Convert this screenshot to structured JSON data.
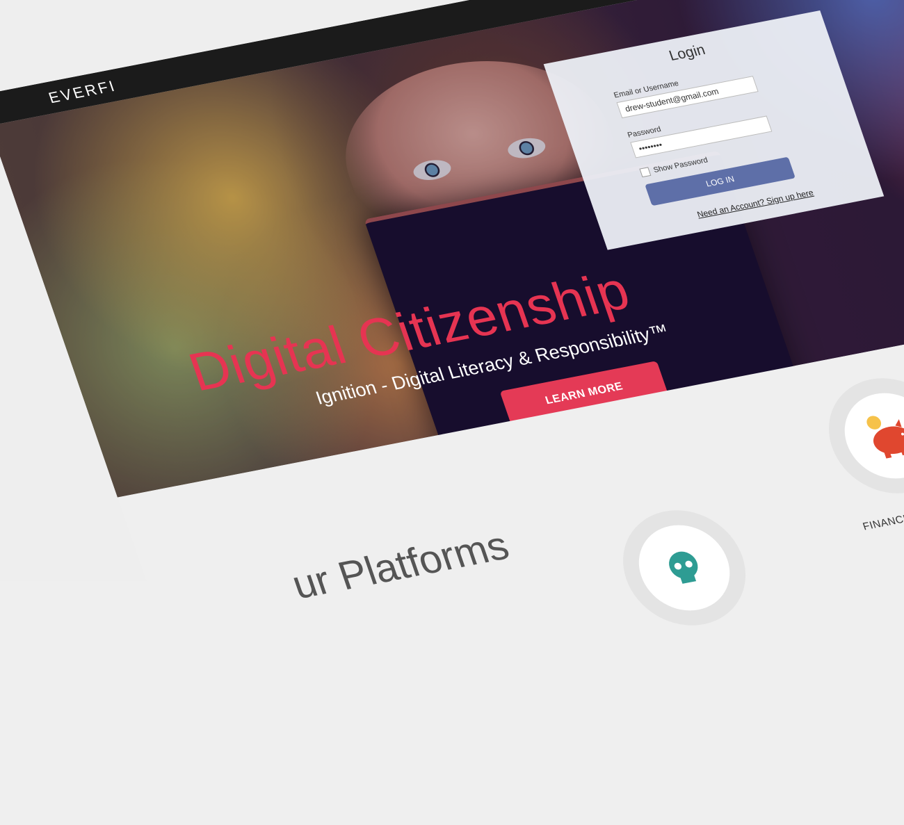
{
  "brand": {
    "logo": "EVERFI"
  },
  "hero": {
    "title": "Digital Citizenship",
    "subtitle": "Ignition - Digital Literacy & Responsibility™",
    "cta_label": "LEARN MORE"
  },
  "login": {
    "title": "Login",
    "email_label": "Email or Username",
    "email_value": "drew-student@gmail.com",
    "password_label": "Password",
    "password_value": "••••••••",
    "show_password_label": "Show Password",
    "submit_label": "LOG IN",
    "signup_link": "Need an Account? Sign up here"
  },
  "platforms": {
    "heading": "ur Platforms",
    "items": [
      {
        "label": "FINANCIAL LITERACY",
        "icon": "piggy-bank-icon"
      },
      {
        "label": "",
        "icon": "skull-icon"
      }
    ]
  },
  "colors": {
    "accent": "#e43a56",
    "login_button": "#5e6fa8",
    "topbar": "#1b1b1b"
  }
}
